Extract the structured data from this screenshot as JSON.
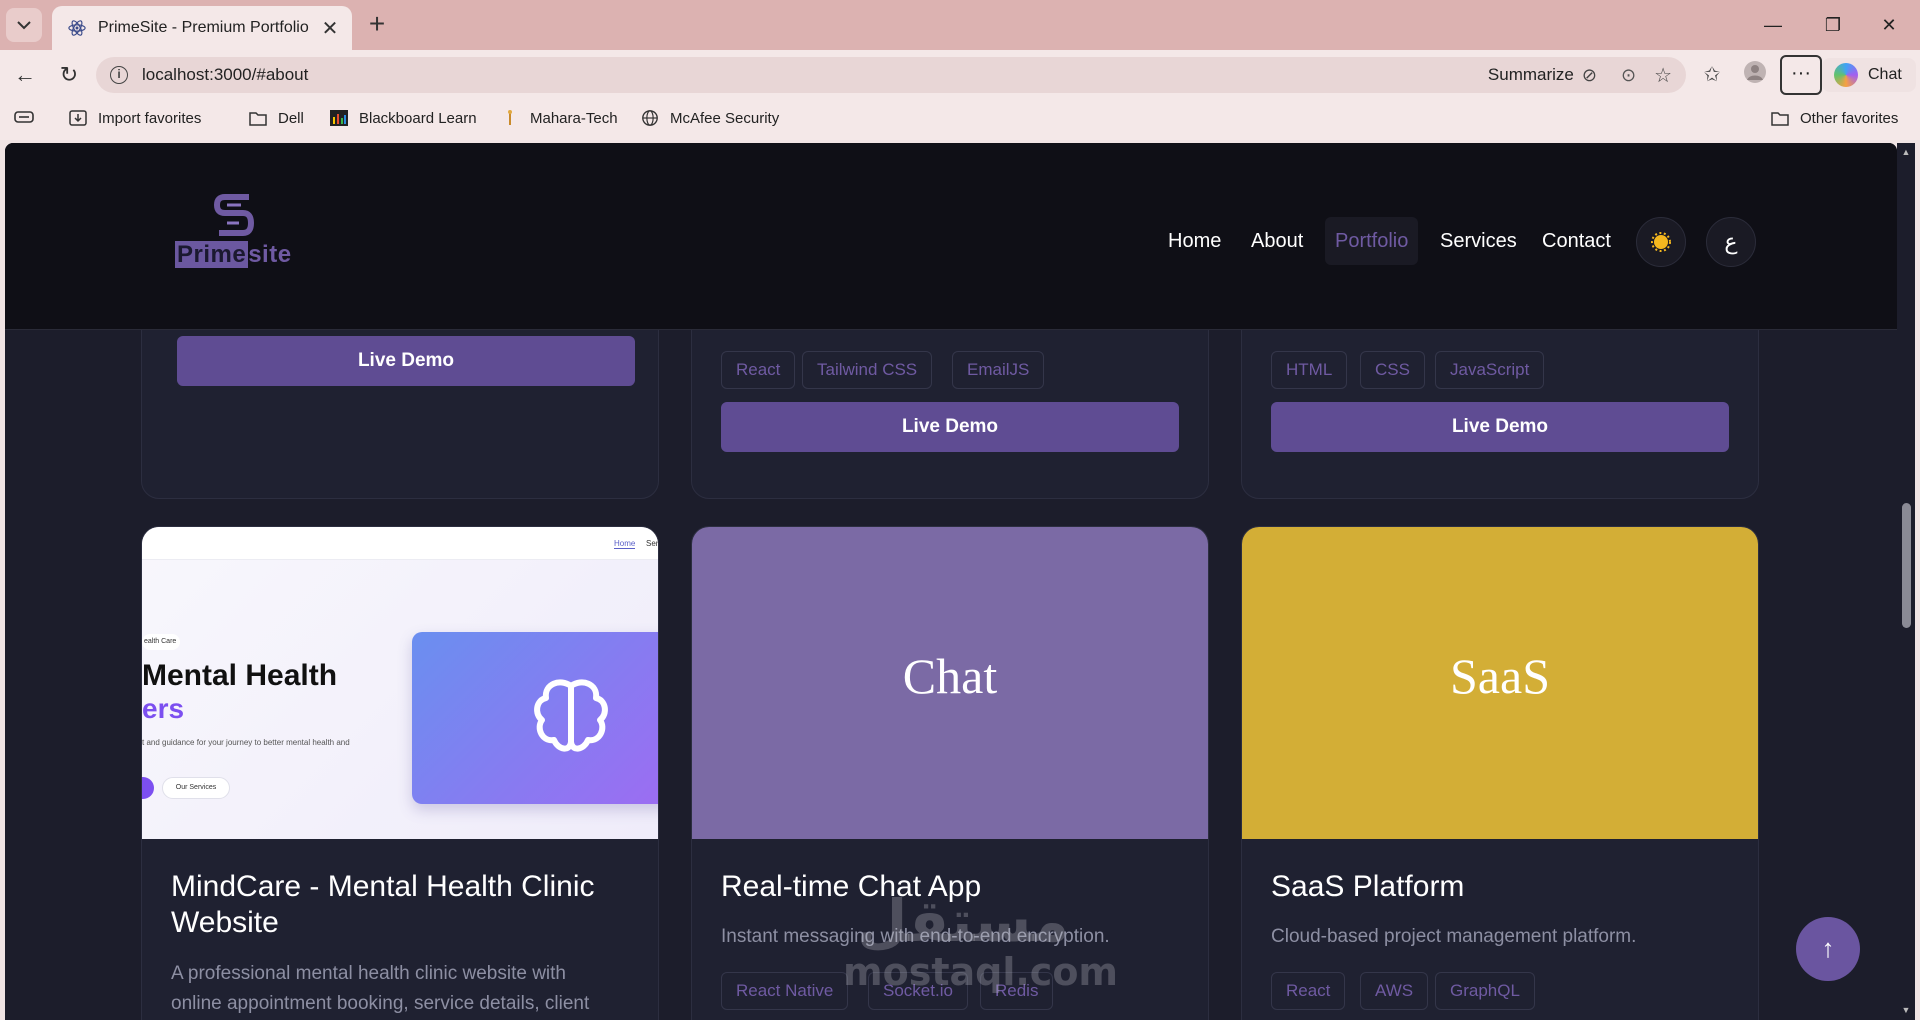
{
  "browser": {
    "tab_title": "PrimeSite - Premium Portfolio",
    "url": "localhost:3000/#about",
    "summarize_label": "Summarize",
    "chat_label": "Chat",
    "favorites": [
      {
        "label": "Import favorites",
        "icon": "import-icon"
      },
      {
        "label": "Dell",
        "icon": "folder-icon"
      },
      {
        "label": "Blackboard Learn",
        "icon": "blackboard-icon"
      },
      {
        "label": "Mahara-Tech",
        "icon": "mahara-icon"
      },
      {
        "label": "McAfee Security",
        "icon": "globe-icon"
      }
    ],
    "other_favorites": "Other favorites"
  },
  "site": {
    "logo_word_a": "Prime",
    "logo_word_b": "site",
    "nav": [
      "Home",
      "About",
      "Portfolio",
      "Services",
      "Contact"
    ],
    "active_nav": "Portfolio",
    "lang_label": "ع",
    "accent_color": "#5f4c93"
  },
  "top_cards": [
    {
      "demo_label": "Live Demo",
      "tags": []
    },
    {
      "demo_label": "Live Demo",
      "tags": [
        "React",
        "Tailwind CSS",
        "EmailJS"
      ]
    },
    {
      "demo_label": "Live Demo",
      "tags": [
        "HTML",
        "CSS",
        "JavaScript"
      ]
    }
  ],
  "projects": [
    {
      "title": "MindCare - Mental Health Clinic Website",
      "title_line1": "MindCare - Mental Health Clinic",
      "title_line2": "Website",
      "desc_line1": "A professional mental health clinic website with",
      "desc_line2": "online appointment booking, service details, client",
      "preview": {
        "nav_home": "Home",
        "nav_next": "Serv",
        "badge": "ealth Care",
        "headline_1": "Mental Health",
        "headline_2": "ers",
        "sub": "t and guidance for your journey to better mental health and",
        "cta": "Our Services"
      }
    },
    {
      "title": "Real-time Chat App",
      "image_text": "Chat",
      "image_color": "#7b6aa5",
      "desc": "Instant messaging with end-to-end encryption.",
      "tags": [
        "React Native",
        "Socket.io",
        "Redis"
      ]
    },
    {
      "title": "SaaS Platform",
      "image_text": "SaaS",
      "image_color": "#d3ae36",
      "desc": "Cloud-based project management platform.",
      "tags": [
        "React",
        "AWS",
        "GraphQL"
      ]
    }
  ],
  "watermark": {
    "arabic": "مستقل",
    "latin": "mostaql.com"
  },
  "scroll_top_label": "↑"
}
